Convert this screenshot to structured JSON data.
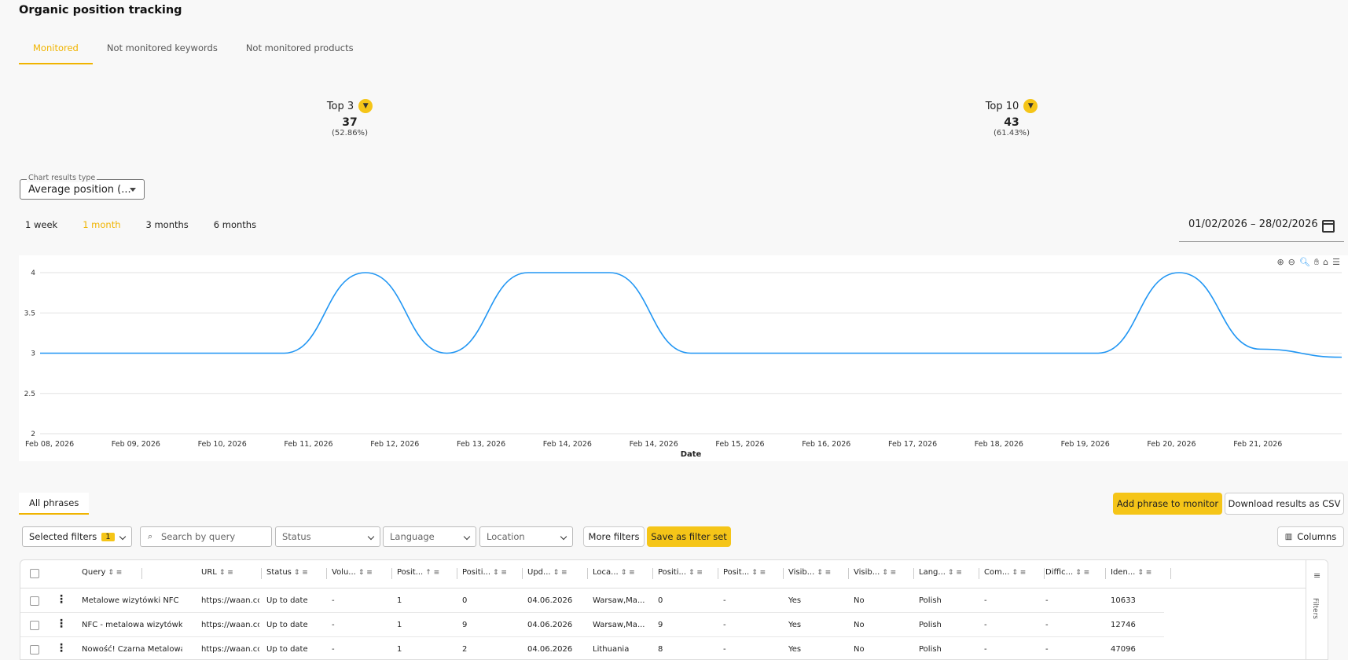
{
  "page_title": "Organic position tracking",
  "tabs": [
    "Monitored",
    "Not monitored keywords",
    "Not monitored products"
  ],
  "kpis": [
    {
      "label": "Top 3",
      "value": "37",
      "pct": "(52.86%)"
    },
    {
      "label": "Top 10",
      "value": "43",
      "pct": "(61.43%)"
    }
  ],
  "chart_results": {
    "legend": "Chart results type",
    "value": "Average position (..."
  },
  "ranges": [
    "1 week",
    "1 month",
    "3 months",
    "6 months"
  ],
  "date_range": "01/02/2026  – 28/02/2026",
  "chart_data": {
    "type": "line",
    "xlabel": "Date",
    "ylabel": "",
    "x": [
      "Feb 08, 2026",
      "Feb 09, 2026",
      "Feb 10, 2026",
      "Feb 11, 2026",
      "Feb 12, 2026",
      "Feb 13, 2026",
      "Feb 14, 2026",
      "Feb 14, 2026",
      "Feb 15, 2026",
      "Feb 16, 2026",
      "Feb 17, 2026",
      "Feb 18, 2026",
      "Feb 19, 2026",
      "Feb 20, 2026",
      "Feb 21, 2026"
    ],
    "series": [
      {
        "values": [
          3,
          3,
          3,
          3,
          4,
          3,
          4,
          4,
          3,
          3,
          3,
          3,
          3,
          3,
          4
        ],
        "color": "#2196f3"
      }
    ],
    "points": [
      3,
      3,
      3,
      3,
      4,
      3,
      4,
      4,
      3,
      3,
      3,
      3,
      3,
      3,
      4,
      3.05,
      2.95
    ],
    "ylim": [
      2,
      4
    ],
    "yticks": [
      "4",
      "3.5",
      "3",
      "2.5",
      "2"
    ],
    "grid": true
  },
  "all_phrases": "All phrases",
  "add_phrase": "Add phrase to monitor",
  "download_csv": "Download results as CSV",
  "selected_filters": {
    "label": "Selected filters",
    "count": "1"
  },
  "search_placeholder": "Search by query",
  "status_placeholder": "Status",
  "language_placeholder": "Language",
  "location_placeholder": "Location",
  "more_filters": "More filters",
  "save_filter_set": "Save as filter set",
  "columns": "Columns",
  "filters_side": "Filters",
  "table": {
    "headers": [
      "Query",
      "URL",
      "Status",
      "Volu...",
      "Posit...",
      "Positi...",
      "Upd...",
      "Loca...",
      "Positi...",
      "Posit...",
      "Visib...",
      "Visib...",
      "Lang...",
      "Com...",
      "Diffic...",
      "Iden..."
    ],
    "rows": [
      [
        "Metalowe wizytówki NFC",
        "https://waan.cc",
        "Up to date",
        "-",
        "1",
        "0",
        "04.06.2026",
        "Warsaw,Ma...",
        "0",
        "-",
        "Yes",
        "No",
        "Polish",
        "-",
        "-",
        "10633"
      ],
      [
        "NFC - metalowa wizytówka",
        "https://waan.cc",
        "Up to date",
        "-",
        "1",
        "9",
        "04.06.2026",
        "Warsaw,Ma...",
        "9",
        "-",
        "Yes",
        "No",
        "Polish",
        "-",
        "-",
        "12746"
      ],
      [
        "Nowość! Czarna Metalowa ...",
        "https://waan.cc",
        "Up to date",
        "-",
        "1",
        "2",
        "04.06.2026",
        "Lithuania",
        "8",
        "-",
        "Yes",
        "No",
        "Polish",
        "-",
        "-",
        "47096"
      ]
    ]
  },
  "colors": {
    "accent": "#f5c518",
    "line": "#2196f3"
  }
}
